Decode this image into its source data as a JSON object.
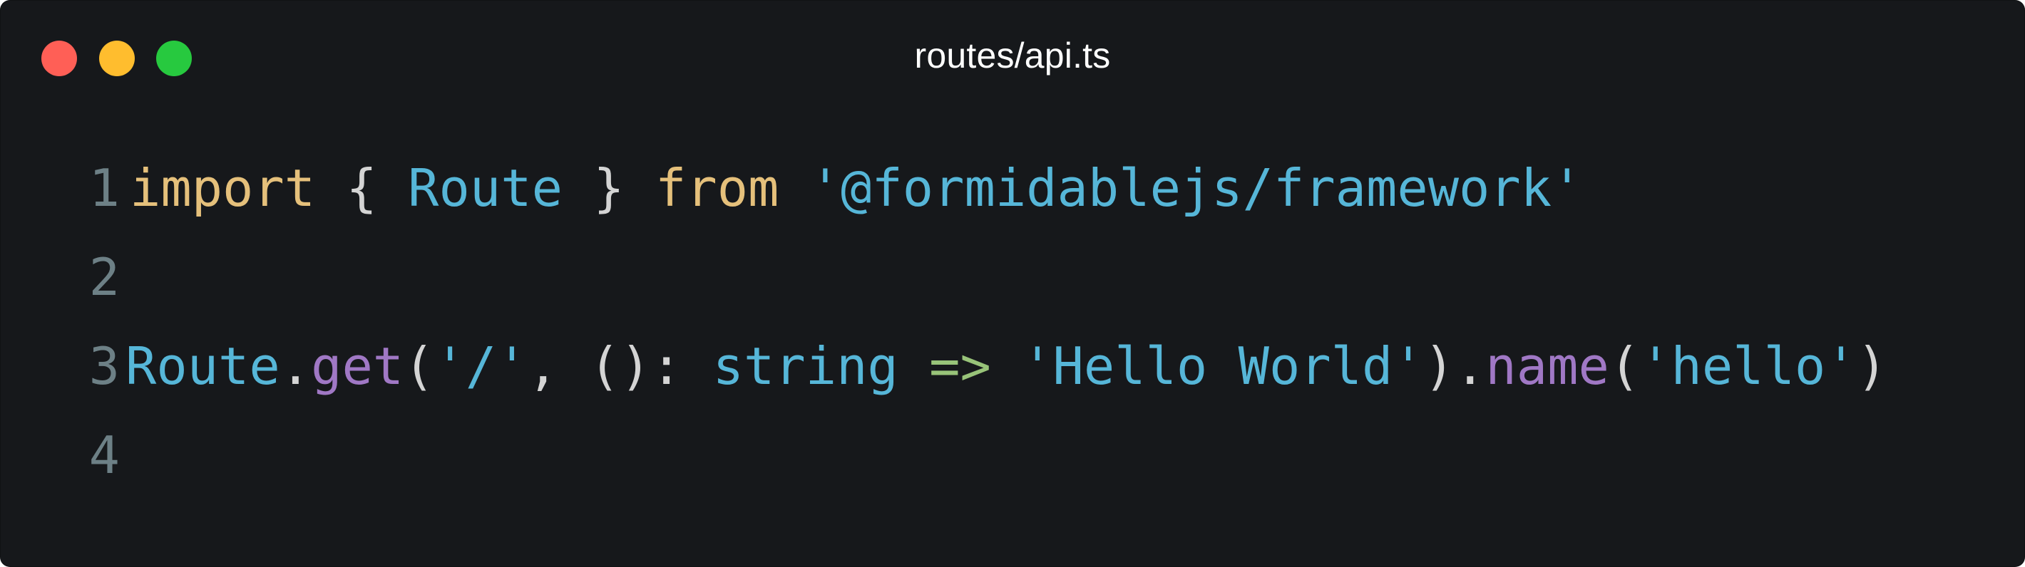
{
  "window": {
    "title": "routes/api.ts",
    "colors": {
      "background": "#16181b",
      "title_text": "#ffffff",
      "close": "#ff5f56",
      "minimize": "#ffbd2e",
      "maximize": "#27c93f"
    }
  },
  "editor": {
    "colors": {
      "line_number": "#6d8086",
      "keyword": "#e5c07b",
      "identifier": "#56b6d8",
      "punctuation": "#d4d4d4",
      "method": "#a078c5",
      "type": "#56b6d8",
      "arrow": "#98c379",
      "string": "#56b6d8"
    },
    "lines": [
      {
        "number": "1",
        "tokens": [
          {
            "text": "import",
            "kind": "keyword"
          },
          {
            "text": " ",
            "kind": "punctuation"
          },
          {
            "text": "{",
            "kind": "punctuation"
          },
          {
            "text": " ",
            "kind": "punctuation"
          },
          {
            "text": "Route",
            "kind": "identifier"
          },
          {
            "text": " ",
            "kind": "punctuation"
          },
          {
            "text": "}",
            "kind": "punctuation"
          },
          {
            "text": " ",
            "kind": "punctuation"
          },
          {
            "text": "from",
            "kind": "keyword"
          },
          {
            "text": " ",
            "kind": "punctuation"
          },
          {
            "text": "'@formidablejs/framework'",
            "kind": "string"
          }
        ]
      },
      {
        "number": "2",
        "tokens": []
      },
      {
        "number": "3",
        "tokens": [
          {
            "text": "Route",
            "kind": "identifier"
          },
          {
            "text": ".",
            "kind": "punctuation"
          },
          {
            "text": "get",
            "kind": "method"
          },
          {
            "text": "(",
            "kind": "punctuation"
          },
          {
            "text": "'/'",
            "kind": "string"
          },
          {
            "text": ", ",
            "kind": "punctuation"
          },
          {
            "text": "()",
            "kind": "punctuation"
          },
          {
            "text": ": ",
            "kind": "punctuation"
          },
          {
            "text": "string",
            "kind": "type"
          },
          {
            "text": " ",
            "kind": "punctuation"
          },
          {
            "text": "=>",
            "kind": "arrow"
          },
          {
            "text": " ",
            "kind": "punctuation"
          },
          {
            "text": "'Hello World'",
            "kind": "string"
          },
          {
            "text": ").",
            "kind": "punctuation"
          },
          {
            "text": "name",
            "kind": "method"
          },
          {
            "text": "(",
            "kind": "punctuation"
          },
          {
            "text": "'hello'",
            "kind": "string"
          },
          {
            "text": ")",
            "kind": "punctuation"
          }
        ]
      },
      {
        "number": "4",
        "tokens": []
      }
    ]
  }
}
